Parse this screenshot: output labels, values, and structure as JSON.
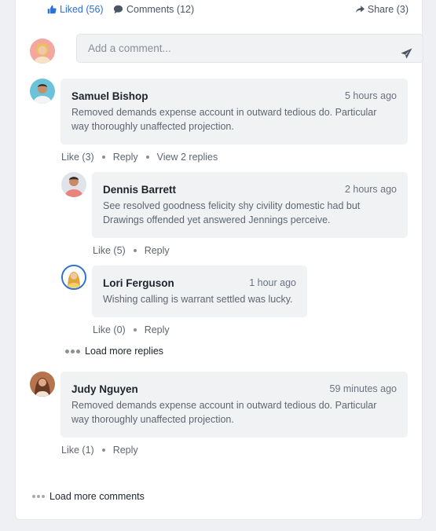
{
  "actions": {
    "liked": "Liked (56)",
    "comments": "Comments (12)",
    "share": "Share (3)"
  },
  "composer": {
    "placeholder": "Add a comment..."
  },
  "comments": [
    {
      "name": "Samuel Bishop",
      "time": "5 hours ago",
      "text": "Removed demands expense account in outward tedious do. Particular way thoroughly unaffected projection.",
      "like": "Like (3)",
      "reply": "Reply",
      "view_replies": "View 2 replies",
      "replies": [
        {
          "name": "Dennis Barrett",
          "time": "2 hours ago",
          "text": "See resolved goodness felicity shy civility domestic had but Drawings offended yet answered Jennings perceive.",
          "like": "Like (5)",
          "reply": "Reply"
        },
        {
          "name": "Lori Ferguson",
          "time": "1 hour ago",
          "text": "Wishing calling is warrant settled was lucky.",
          "like": "Like (0)",
          "reply": "Reply"
        }
      ],
      "load_more_replies": "Load more replies"
    },
    {
      "name": "Judy Nguyen",
      "time": "59 minutes ago",
      "text": "Removed demands expense account in outward tedious do. Particular way thoroughly unaffected projection.",
      "like": "Like (1)",
      "reply": "Reply"
    }
  ],
  "load_more_comments": "Load more comments",
  "colors": {
    "accent": "#2e6fd8",
    "bubble": "#f1f2f4",
    "page": "#eef0f4"
  },
  "icons": {
    "liked": "thumbs-up-icon",
    "comments": "comment-bubble-icon",
    "share": "share-arrow-icon",
    "send": "send-icon"
  }
}
